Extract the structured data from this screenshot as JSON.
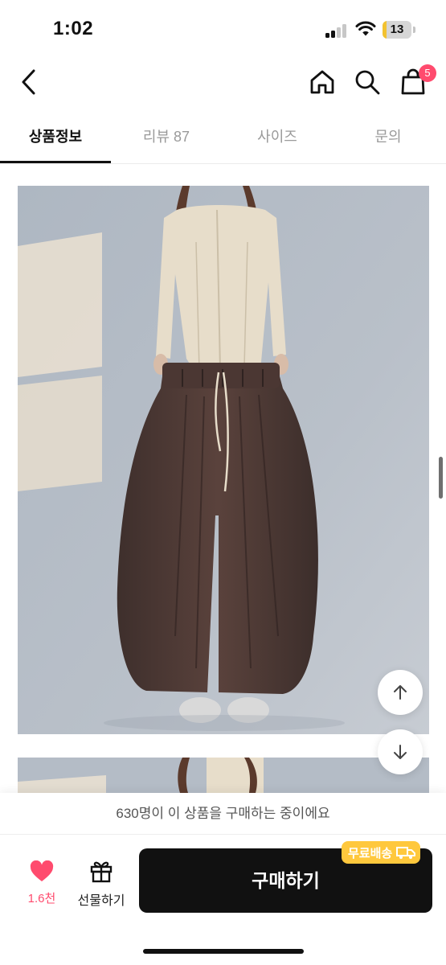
{
  "status_bar": {
    "time": "1:02",
    "battery_level": "13",
    "battery_color": "#f2c230"
  },
  "header": {
    "back_icon": "chevron-left-icon",
    "home_icon": "home-icon",
    "search_icon": "search-icon",
    "cart_icon": "shopping-bag-icon",
    "cart_badge": "5"
  },
  "tabs": [
    {
      "label": "상품정보",
      "active": true
    },
    {
      "label": "리뷰 87",
      "active": false
    },
    {
      "label": "사이즈",
      "active": false
    },
    {
      "label": "문의",
      "active": false
    }
  ],
  "floating": {
    "scroll_up_icon": "arrow-up-icon",
    "scroll_down_icon": "arrow-down-icon"
  },
  "bottom_bar": {
    "buying_now": "630명이 이 상품을 구매하는 중이에요",
    "like_count": "1.6천",
    "gift_label": "선물하기",
    "buy_label": "구매하기",
    "free_shipping": "무료배송",
    "accent_color": "#ff4b6e"
  }
}
